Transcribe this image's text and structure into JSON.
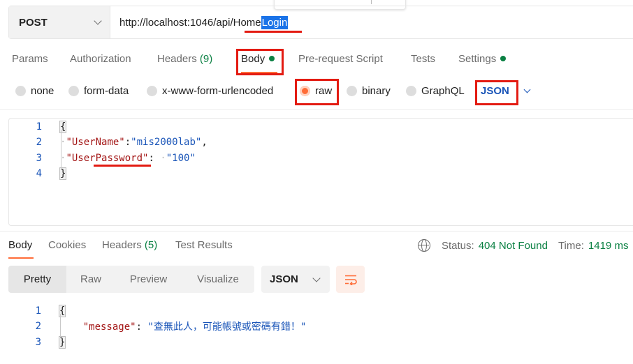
{
  "request": {
    "method": "POST",
    "url_prefix": "http://localhost:1046/api/Home",
    "url_selected": "Login"
  },
  "tabs": [
    {
      "label": "Params"
    },
    {
      "label": "Authorization"
    },
    {
      "label": "Headers",
      "count": "(9)"
    },
    {
      "label": "Body"
    },
    {
      "label": "Pre-request Script"
    },
    {
      "label": "Tests"
    },
    {
      "label": "Settings"
    }
  ],
  "active_tab": "Body",
  "body_types": [
    {
      "label": "none"
    },
    {
      "label": "form-data"
    },
    {
      "label": "x-www-form-urlencoded"
    },
    {
      "label": "raw"
    },
    {
      "label": "binary"
    },
    {
      "label": "GraphQL"
    }
  ],
  "selected_body_type": "raw",
  "raw_language": "JSON",
  "request_body": {
    "line_numbers": [
      "1",
      "2",
      "3",
      "4"
    ],
    "open_brace": "{",
    "close_brace": "}",
    "key1": "\"UserName\"",
    "val1": "\"mis2000lab\"",
    "key2": "\"UserPassword\"",
    "val2": "\"100\""
  },
  "response_tabs": [
    {
      "label": "Body"
    },
    {
      "label": "Cookies"
    },
    {
      "label": "Headers",
      "count": "(5)"
    },
    {
      "label": "Test Results"
    }
  ],
  "status": {
    "label": "Status:",
    "value": "404 Not Found",
    "time_label": "Time:",
    "time_value": "1419 ms"
  },
  "response_views": [
    "Pretty",
    "Raw",
    "Preview",
    "Visualize"
  ],
  "active_view": "Pretty",
  "response_format": "JSON",
  "response_body": {
    "line_numbers": [
      "1",
      "2",
      "3"
    ],
    "open_brace": "{",
    "close_brace": "}",
    "key": "\"message\"",
    "value": "\"查無此人，可能帳號或密碼有錯！\""
  },
  "colors": {
    "accent": "#ff6c37",
    "success": "#0b8043",
    "selection": "#1a73e8",
    "annotation": "#e31b12"
  }
}
